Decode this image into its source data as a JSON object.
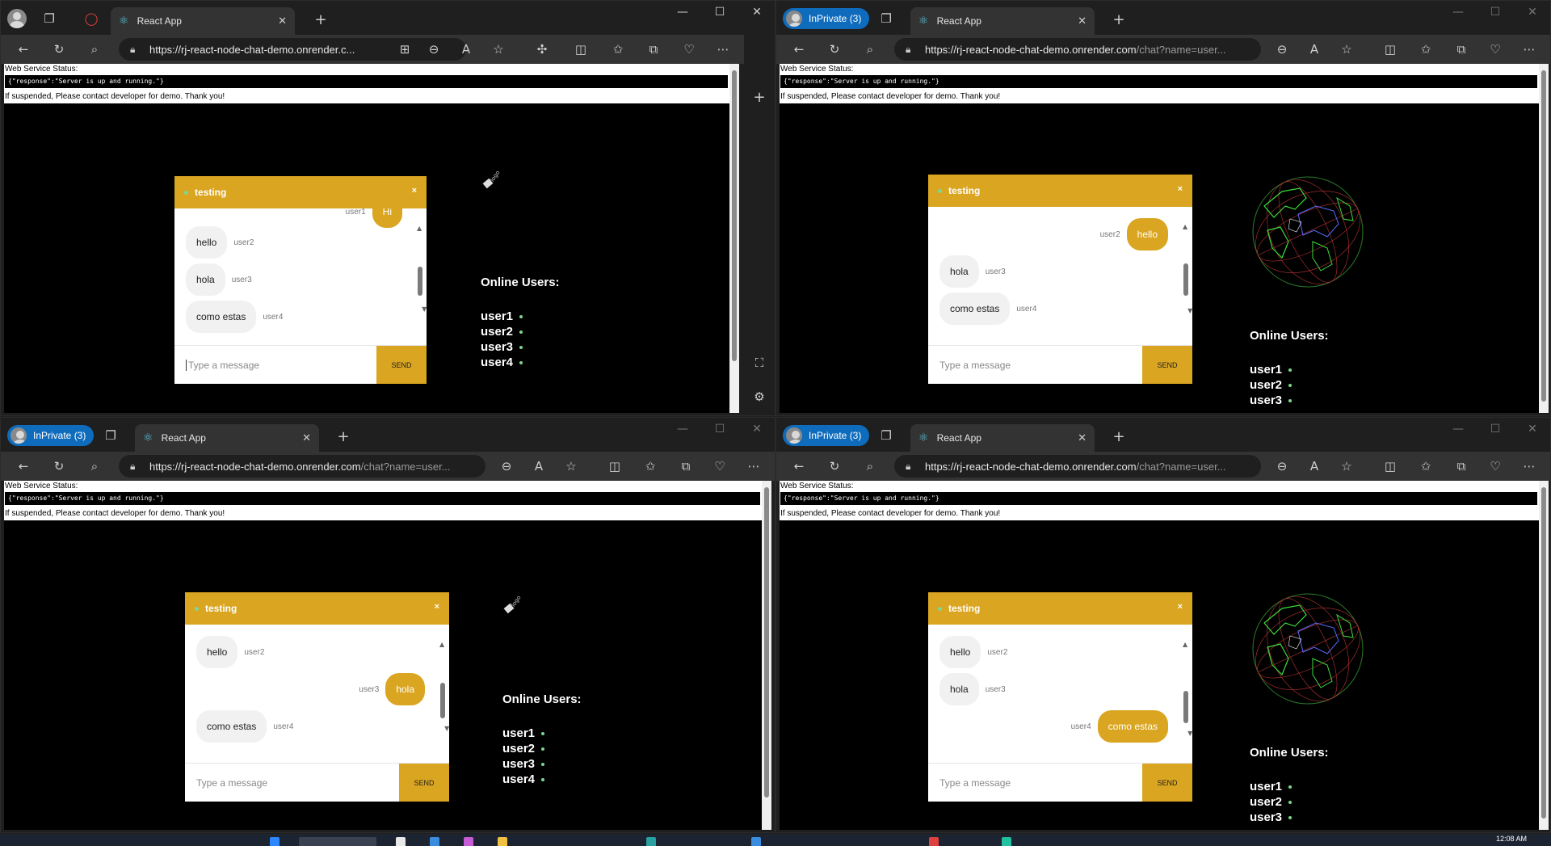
{
  "windows": [
    {
      "id": "tl",
      "private": false,
      "private_label": "",
      "tab_title": "React App",
      "url_main": "https://rj-react-node-chat-demo.onrender.c...",
      "url_dim": "",
      "status_label": "Web Service Status:",
      "status_response": "{\"response\":\"Server is up and running.\"}",
      "status_note": "If suspended, Please contact developer for demo. Thank you!",
      "chat_title": "testing",
      "chat_close": "×",
      "input_placeholder": "Type a message",
      "send_label": "SEND",
      "online_title": "Online Users:",
      "online_users": [
        "user1",
        "user2",
        "user3",
        "user4"
      ],
      "messages": [
        {
          "text": "Hi",
          "user": "user1",
          "mine": true
        },
        {
          "text": "hello",
          "user": "user2",
          "mine": false
        },
        {
          "text": "hola",
          "user": "user3",
          "mine": false
        },
        {
          "text": "como estas",
          "user": "user4",
          "mine": false
        }
      ],
      "graphic": "broken-logo"
    },
    {
      "id": "tr",
      "private": true,
      "private_label": "InPrivate (3)",
      "tab_title": "React App",
      "url_main": "https://rj-react-node-chat-demo.onrender.com",
      "url_dim": "/chat?name=user...",
      "status_label": "Web Service Status:",
      "status_response": "{\"response\":\"Server is up and running.\"}",
      "status_note": "If suspended, Please contact developer for demo. Thank you!",
      "chat_title": "testing",
      "chat_close": "×",
      "input_placeholder": "Type a message",
      "send_label": "SEND",
      "online_title": "Online Users:",
      "online_users": [
        "user1",
        "user2",
        "user3"
      ],
      "messages": [
        {
          "text": "hello",
          "user": "user2",
          "mine": true
        },
        {
          "text": "hola",
          "user": "user3",
          "mine": false
        },
        {
          "text": "como estas",
          "user": "user4",
          "mine": false
        }
      ],
      "graphic": "globe"
    },
    {
      "id": "bl",
      "private": true,
      "private_label": "InPrivate (3)",
      "tab_title": "React App",
      "url_main": "https://rj-react-node-chat-demo.onrender.com",
      "url_dim": "/chat?name=user...",
      "status_label": "Web Service Status:",
      "status_response": "{\"response\":\"Server is up and running.\"}",
      "status_note": "If suspended, Please contact developer for demo. Thank you!",
      "chat_title": "testing",
      "chat_close": "×",
      "input_placeholder": "Type a message",
      "send_label": "SEND",
      "online_title": "Online Users:",
      "online_users": [
        "user1",
        "user2",
        "user3",
        "user4"
      ],
      "messages": [
        {
          "text": "hello",
          "user": "user2",
          "mine": false
        },
        {
          "text": "hola",
          "user": "user3",
          "mine": true
        },
        {
          "text": "como estas",
          "user": "user4",
          "mine": false
        }
      ],
      "graphic": "broken-logo"
    },
    {
      "id": "br",
      "private": true,
      "private_label": "InPrivate (3)",
      "tab_title": "React App",
      "url_main": "https://rj-react-node-chat-demo.onrender.com",
      "url_dim": "/chat?name=user...",
      "status_label": "Web Service Status:",
      "status_response": "{\"response\":\"Server is up and running.\"}",
      "status_note": "If suspended, Please contact developer for demo. Thank you!",
      "chat_title": "testing",
      "chat_close": "×",
      "input_placeholder": "Type a message",
      "send_label": "SEND",
      "online_title": "Online Users:",
      "online_users": [
        "user1",
        "user2",
        "user3"
      ],
      "messages": [
        {
          "text": "hello",
          "user": "user2",
          "mine": false
        },
        {
          "text": "hola",
          "user": "user3",
          "mine": false
        },
        {
          "text": "como estas",
          "user": "user4",
          "mine": true
        }
      ],
      "graphic": "globe"
    }
  ],
  "icons": {
    "back": "back-arrow-icon",
    "refresh": "refresh-icon",
    "search": "search-icon",
    "lock": "lock-icon",
    "favorites": "star-icon",
    "more": "more-icon"
  },
  "colors": {
    "accent": "#daa520",
    "online_dot": "#7bd88f",
    "inprivate": "#0f6cbd"
  },
  "taskbar": {
    "clock": "12:08 AM"
  }
}
